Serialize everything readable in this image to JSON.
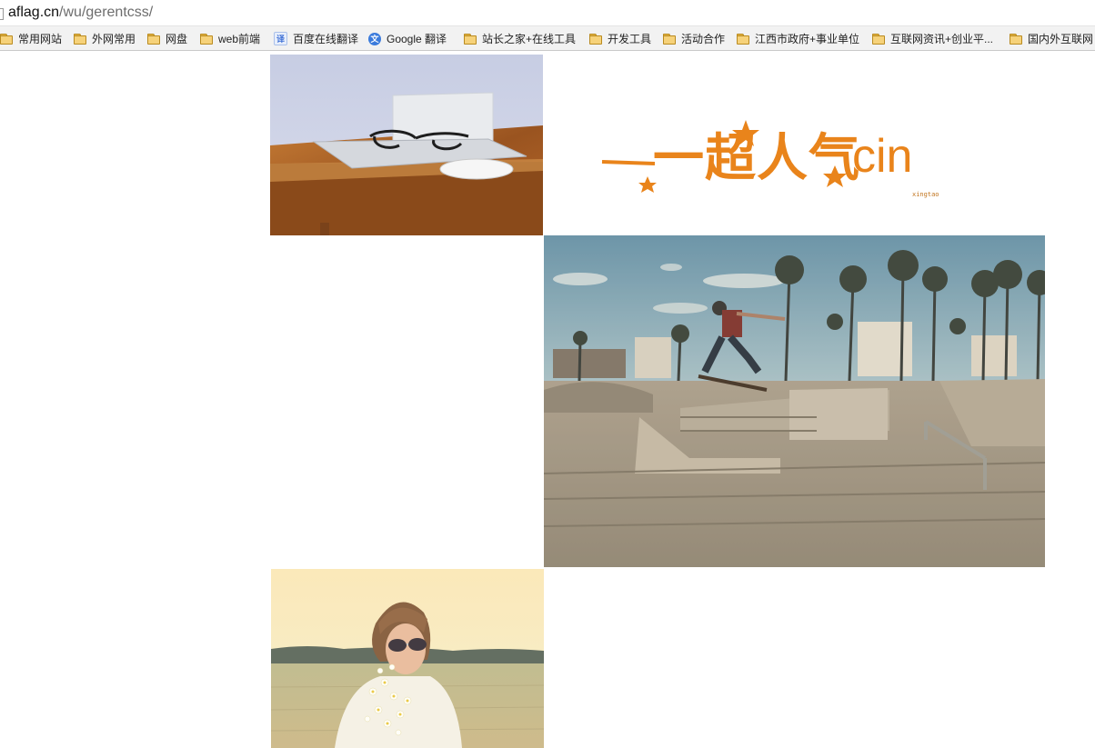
{
  "address_bar": {
    "host": "aflag.cn",
    "path": "/wu/gerentcss/"
  },
  "bookmarks": [
    {
      "label": "常用网站",
      "icon": "folder-icon"
    },
    {
      "label": "外网常用",
      "icon": "folder-icon"
    },
    {
      "label": "网盘",
      "icon": "folder-icon"
    },
    {
      "label": "web前端",
      "icon": "folder-icon"
    },
    {
      "label": "百度在线翻译",
      "icon": "baidu-translate-icon"
    },
    {
      "label": "Google 翻译",
      "icon": "google-translate-icon"
    },
    {
      "label": "站长之家+在线工具",
      "icon": "folder-icon"
    },
    {
      "label": "开发工具",
      "icon": "folder-icon"
    },
    {
      "label": "活动合作",
      "icon": "folder-icon"
    },
    {
      "label": "江西市政府+事业单位",
      "icon": "folder-icon"
    },
    {
      "label": "互联网资讯+创业平...",
      "icon": "folder-icon"
    },
    {
      "label": "国内外互联网",
      "icon": "folder-icon"
    }
  ],
  "logo": {
    "text": "一超人气",
    "suffix": "cin",
    "sub": "xingtao"
  },
  "colors": {
    "logo_orange": "#e9841b",
    "bookmark_bar": "#f2f2f2"
  }
}
